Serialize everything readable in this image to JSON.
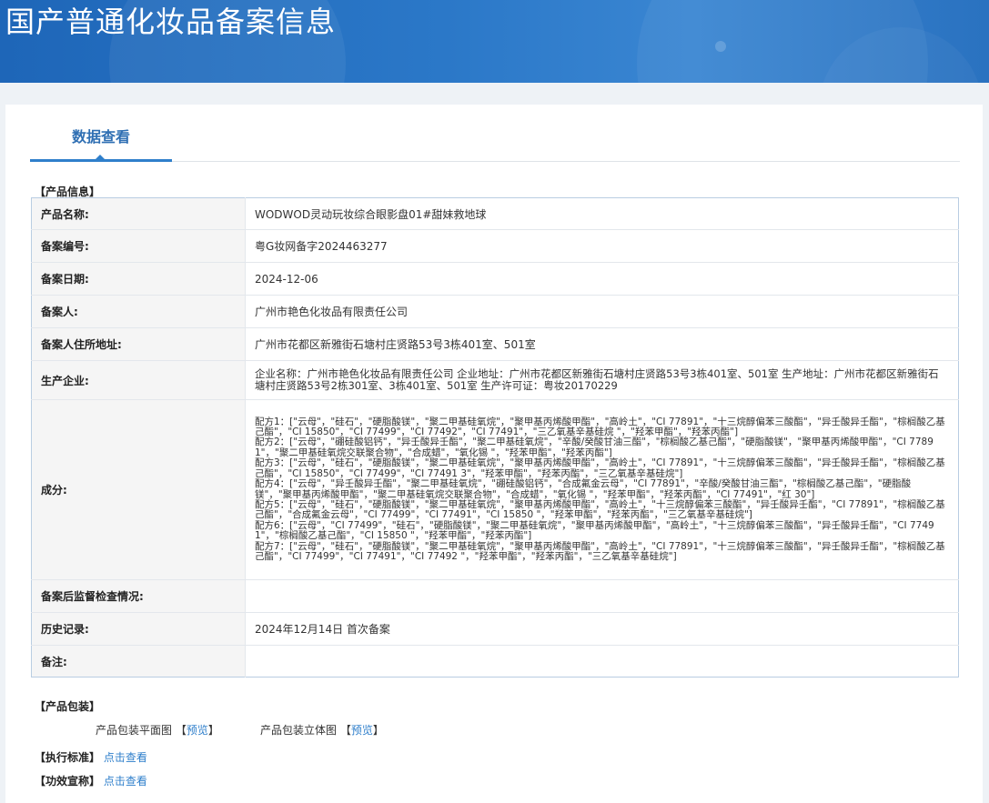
{
  "header": {
    "title": "国产普通化妆品备案信息"
  },
  "tabs": [
    {
      "label": "数据查看"
    }
  ],
  "product_info": {
    "section_title": "【产品信息】",
    "rows": [
      {
        "label": "产品名称:",
        "value": "WODWOD灵动玩妆综合眼影盘01#甜妹救地球"
      },
      {
        "label": "备案编号:",
        "value": "粤G妆网备字2024463277"
      },
      {
        "label": "备案日期:",
        "value": "2024-12-06"
      },
      {
        "label": "备案人:",
        "value": "广州市艳色化妆品有限责任公司"
      },
      {
        "label": "备案人住所地址:",
        "value": "广州市花都区新雅街石塘村庄贤路53号3栋401室、501室"
      },
      {
        "label": "生产企业:",
        "value": "企业名称：广州市艳色化妆品有限责任公司 企业地址：广州市花都区新雅街石塘村庄贤路53号3栋401室、501室 生产地址：广州市花都区新雅街石塘村庄贤路53号2栋301室、3栋401室、501室 生产许可证：粤妆20170229"
      },
      {
        "label": "成分:",
        "value": "",
        "lines": [
          "配方1：[\"云母\"，\"硅石\"，\"硬脂酸镁\"，\"聚二甲基硅氧烷\"，\"聚甲基丙烯酸甲酯\"，\"高岭土\"，\"CI 77891\"，\"十三烷醇偏苯三酸酯\"，\"异壬酸异壬酯\"，\"棕榈酸乙基己酯\"，\"CI 15850\"，\"CI 77499\"，\"CI 77492\"，\"CI 77491\"，\"三乙氧基辛基硅烷 \"，\"羟苯甲酯\"，\"羟苯丙酯\"]",
          "配方2：[\"云母\"，\"硼硅酸铝钙\"，\"异壬酸异壬酯\"，\"聚二甲基硅氧烷\"，\"辛酸/癸酸甘油三酯\"，\"棕榈酸乙基己酯\"，\"硬脂酸镁\"，\"聚甲基丙烯酸甲酯\"，\"CI 77891\"，\"聚二甲基硅氧烷交联聚合物\"，\"合成蜡\"，\"氧化锡 \"，\"羟苯甲酯\"，\"羟苯丙酯\"]",
          "配方3：[\"云母\"，\"硅石\"，\"硬脂酸镁\"，\"聚二甲基硅氧烷\"，\"聚甲基丙烯酸甲酯\"，\"高岭土\"，\"CI 77891\"，\"十三烷醇偏苯三酸酯\"，\"异壬酸异壬酯\"，\"棕榈酸乙基己酯\"，\"CI 15850\"，\"CI 77499\"，\"CI 77491 3\"，\"羟苯甲酯\"，\"羟苯丙酯\"，\"三乙氧基辛基硅烷\"]",
          "配方4：[\"云母\"，\"异壬酸异壬酯\"，\"聚二甲基硅氧烷\"，\"硼硅酸铝钙\"，\"合成氟金云母\"，\"CI 77891\"，\"辛酸/癸酸甘油三酯\"，\"棕榈酸乙基己酯\"，\"硬脂酸镁\"，\"聚甲基丙烯酸甲酯\"，\"聚二甲基硅氧烷交联聚合物\"，\"合成蜡\"，\"氧化锡 \"，\"羟苯甲酯\"，\"羟苯丙酯\"，\"CI 77491\"，\"红 30\"]",
          "配方5：[\"云母\"，\"硅石\"，\"硬脂酸镁\"，\"聚二甲基硅氧烷\"，\"聚甲基丙烯酸甲酯\"，\"高岭土\"，\"十三烷醇偏苯三酸酯\"，\"异壬酸异壬酯\"，\"CI 77891\"，\"棕榈酸乙基己酯\"，\"合成氟金云母\"，\"CI 77499\"，\"CI 77491\"，\"CI 15850 \"，\"羟苯甲酯\"，\"羟苯丙酯\"，\"三乙氧基辛基硅烷\"]",
          "配方6：[\"云母\"，\"CI 77499\"，\"硅石\"，\"硬脂酸镁\"，\"聚二甲基硅氧烷\"，\"聚甲基丙烯酸甲酯\"，\"高岭土\"，\"十三烷醇偏苯三酸酯\"，\"异壬酸异壬酯\"，\"CI 77491\"，\"棕榈酸乙基己酯\"，\"CI 15850 \"，\"羟苯甲酯\"，\"羟苯丙酯\"]",
          "配方7：[\"云母\"，\"硅石\"，\"硬脂酸镁\"，\"聚二甲基硅氧烷\"，\"聚甲基丙烯酸甲酯\"，\"高岭土\"，\"CI 77891\"，\"十三烷醇偏苯三酸酯\"，\"异壬酸异壬酯\"，\"棕榈酸乙基己酯\"，\"CI 77499\"，\"CI 77491\"，\"CI 77492 \"，\"羟苯甲酯\"，\"羟苯丙酯\"，\"三乙氧基辛基硅烷\"]"
        ]
      },
      {
        "label": "备案后监督检查情况:",
        "value": ""
      },
      {
        "label": "历史记录:",
        "value": "2024年12月14日 首次备案"
      },
      {
        "label": "备注:",
        "value": ""
      }
    ]
  },
  "packaging": {
    "section_title": "【产品包装】",
    "flat_label": "产品包装平面图",
    "solid_label": "产品包装立体图",
    "preview_left": "【",
    "preview_text": "预览",
    "preview_right": "】"
  },
  "standard": {
    "label": "【执行标准】",
    "link": "点击查看"
  },
  "efficacy": {
    "label": "【功效宣称】",
    "link": "点击查看"
  }
}
